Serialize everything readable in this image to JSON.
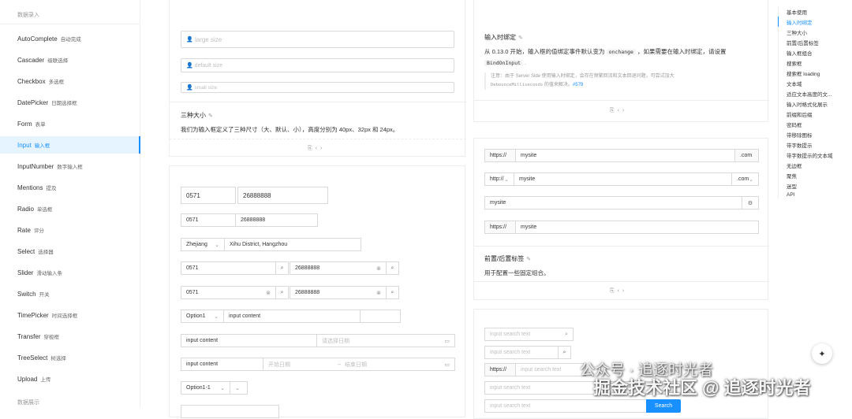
{
  "sidebar": {
    "group_top": "数据录入",
    "group_bottom": "数据展示",
    "items": [
      {
        "label": "AutoComplete",
        "cn": "自动完成"
      },
      {
        "label": "Cascader",
        "cn": "级联选择"
      },
      {
        "label": "Checkbox",
        "cn": "多选框"
      },
      {
        "label": "DatePicker",
        "cn": "日期选择框"
      },
      {
        "label": "Form",
        "cn": "表单"
      },
      {
        "label": "Input",
        "cn": "输入框"
      },
      {
        "label": "InputNumber",
        "cn": "数字输入框"
      },
      {
        "label": "Mentions",
        "cn": "提及"
      },
      {
        "label": "Radio",
        "cn": "单选框"
      },
      {
        "label": "Rate",
        "cn": "评分"
      },
      {
        "label": "Select",
        "cn": "选择器"
      },
      {
        "label": "Slider",
        "cn": "滑动输入条"
      },
      {
        "label": "Switch",
        "cn": "开关"
      },
      {
        "label": "TimePicker",
        "cn": "时间选择框"
      },
      {
        "label": "Transfer",
        "cn": "穿梭框"
      },
      {
        "label": "TreeSelect",
        "cn": "树选择"
      },
      {
        "label": "Upload",
        "cn": "上传"
      }
    ]
  },
  "size_demo": {
    "large_placeholder": "large size",
    "default_placeholder": "default size",
    "small_placeholder": "small size",
    "title": "三种大小",
    "desc": "我们为输入框定义了三种尺寸（大、默认、小），高度分别为 40px、32px 和 24px。"
  },
  "group_demo": {
    "area_code": "0571",
    "phone": "26888888",
    "province": "Zhejiang",
    "address": "Xihu District, Hangzhou",
    "option1": "Option1",
    "input_content": "input content",
    "date_placeholder": "请选择日期",
    "start_date": "开始日期",
    "end_date": "结束日期",
    "option11": "Option1-1"
  },
  "binding_demo": {
    "title": "输入时绑定",
    "line1_a": "从 0.13.0 开始，输入框的值绑定事件默认变为",
    "onchange": "onchange",
    "line1_b": "，如果需要在输入时绑定，请设置",
    "bind_on_input": "BindOnInput",
    "note_a": "注意：由于 Server Side 使用输入时绑定，会存在频繁回流和文本回退问题，可尝试加大",
    "debounce": "DebounceMilliseconds",
    "note_b": "的值来解决。",
    "issue": "#579"
  },
  "addon_demo": {
    "https": "https://",
    "http": "http://",
    "mysite": "mysite",
    "com": ".com",
    "title": "前置/后置标签",
    "desc": "用于配置一些固定组合。"
  },
  "search_demo": {
    "placeholder": "input search text",
    "https": "https://",
    "search_button": "Search"
  },
  "anchor": [
    "基本使用",
    "输入时绑定",
    "三种大小",
    "前置/后置标签",
    "输入框组合",
    "搜索框",
    "搜索框 loading",
    "文本域",
    "适应文本高度的文...",
    "输入时格式化展示",
    "前缀和后缀",
    "密码框",
    "带移除图标",
    "带字数提示",
    "带字数提示的文本域",
    "无边框",
    "聚焦",
    "迷型",
    "API"
  ],
  "watermark": {
    "line1": "公众号 · 追逐时光者",
    "line2": "掘金技术社区 @ 追逐时光者"
  }
}
